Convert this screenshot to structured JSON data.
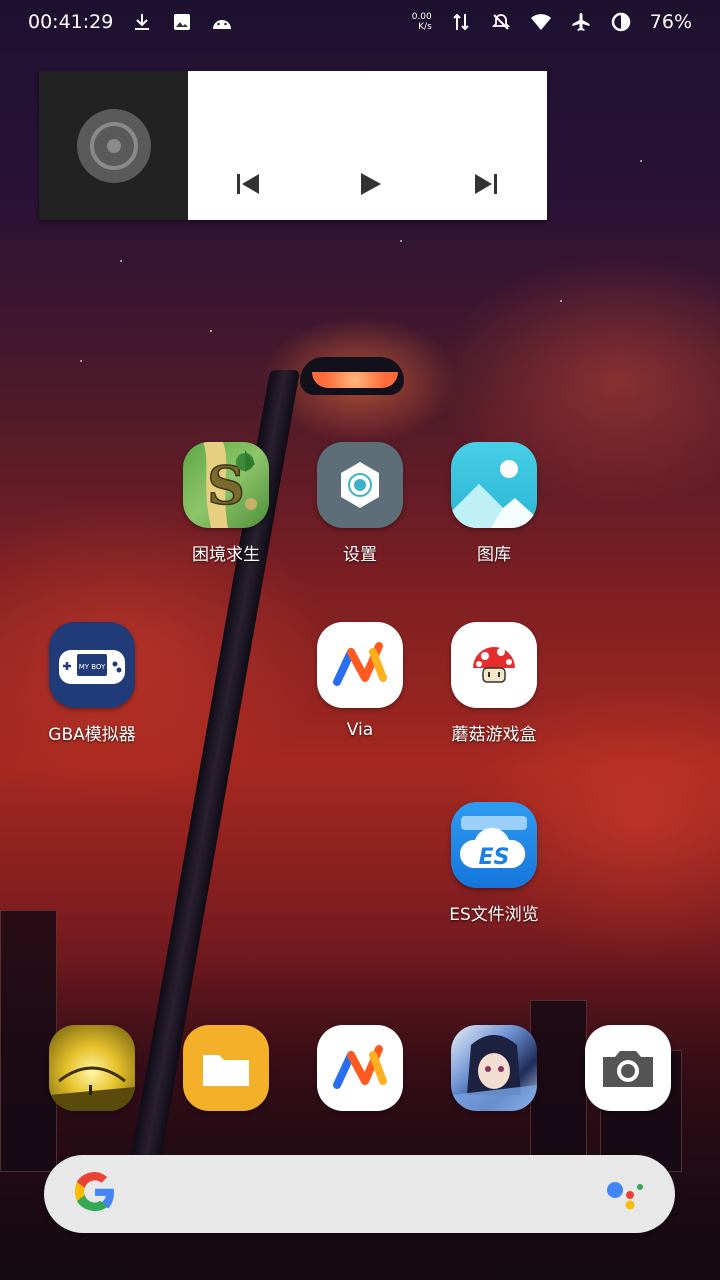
{
  "status_bar": {
    "time": "00:41:29",
    "net_speed_value": "0.00",
    "net_speed_unit": "K/s",
    "battery_percent": "76%",
    "icons": [
      "download-icon",
      "image-icon",
      "android-icon",
      "data-arrows-icon",
      "mute-icon",
      "wifi-icon",
      "airplane-icon",
      "battery-saver-icon"
    ]
  },
  "music_widget": {
    "album_art": "disc-icon",
    "controls": [
      "previous-icon",
      "play-icon",
      "next-icon"
    ]
  },
  "apps": [
    {
      "label": "困境求生"
    },
    {
      "label": "设置"
    },
    {
      "label": "图库"
    },
    {
      "label": "GBA模拟器"
    },
    {
      "label": "Via"
    },
    {
      "label": "蘑菇游戏盒"
    },
    {
      "label": "ES文件浏览"
    }
  ],
  "dock": {
    "apps": [
      "yellow-scene-app",
      "files-app",
      "via-app",
      "anime-app",
      "camera-app"
    ]
  },
  "search": {
    "logo": "google-logo",
    "assistant": "assistant-icon"
  },
  "colors": {
    "settings_icon_bg": "#5e6e79",
    "gallery_bg": "#3ac6e0",
    "files_bg": "#f4b029",
    "es_bg": "#1e8be8",
    "via_orange": "#ff5a1f",
    "via_blue": "#2a6ef0"
  }
}
